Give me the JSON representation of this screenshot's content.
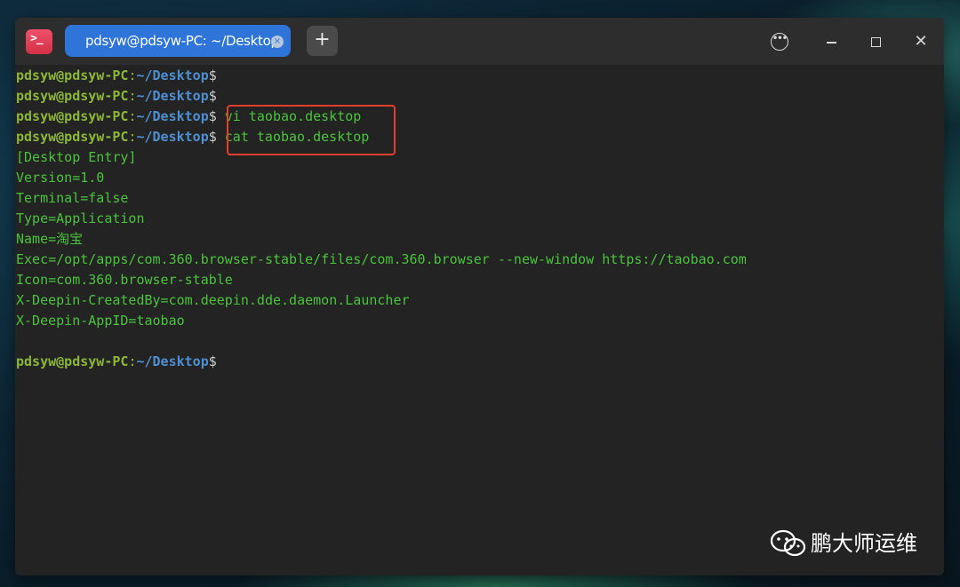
{
  "window": {
    "tab_title": "pdsyw@pdsyw-PC: ~/Desktop",
    "tab_close_label": "×",
    "new_tab_label": "+",
    "menu_label": "•••",
    "close_label": "✕"
  },
  "prompt": {
    "user": "pdsyw@pdsyw-PC",
    "colon": ":",
    "path": "~/Desktop",
    "dollar": "$"
  },
  "terminal": {
    "commands": [
      "",
      "",
      "vi taobao.desktop",
      "cat taobao.desktop"
    ],
    "output": [
      "[Desktop Entry]",
      "Version=1.0",
      "Terminal=false",
      "Type=Application",
      "Name=淘宝",
      "Exec=/opt/apps/com.360.browser-stable/files/com.360.browser --new-window https://taobao.com",
      "Icon=com.360.browser-stable",
      "X-Deepin-CreatedBy=com.deepin.dde.daemon.Launcher",
      "X-Deepin-AppID=taobao"
    ],
    "final_command": ""
  },
  "watermark": {
    "text": "鹏大师运维"
  },
  "colors": {
    "prompt_user": "#8bb637",
    "prompt_path": "#4d8fd0",
    "output_text": "#4ac33c",
    "highlight_border": "#e2402c",
    "tab_active": "#2f74d8"
  },
  "icons": [
    "terminal-app-icon",
    "tab-close-icon",
    "plus-icon",
    "more-menu-icon",
    "minimize-icon",
    "maximize-icon",
    "close-icon",
    "wechat-icon"
  ]
}
